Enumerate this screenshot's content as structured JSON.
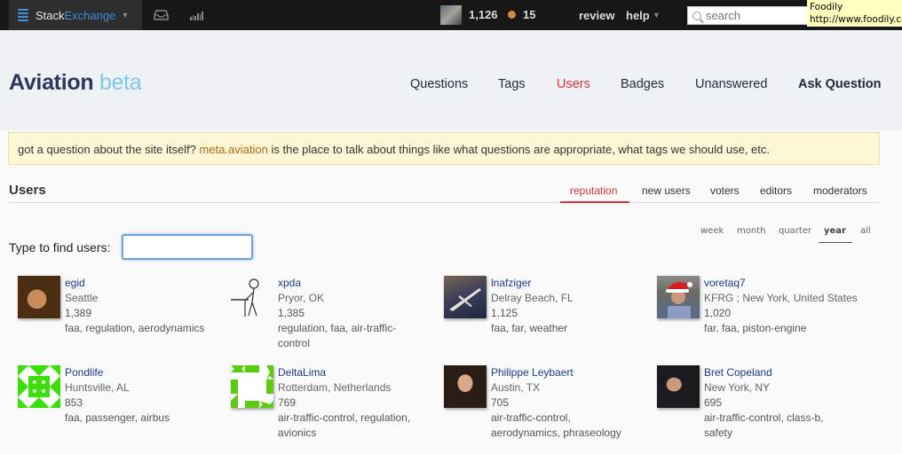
{
  "topbar": {
    "brand_left": "Stack",
    "brand_right": "Exchange",
    "reputation": "1,126",
    "bronze_badges": "15",
    "review_label": "review",
    "help_label": "help",
    "search_placeholder": "search",
    "icons": {
      "logo": "stackexchange-logo-icon",
      "caret": "caret-down-icon",
      "inbox": "inbox-icon",
      "achievements": "achievements-icon",
      "search": "search-icon"
    }
  },
  "tooltip": {
    "title": "Foodily",
    "url": "http://www.foodily.com"
  },
  "header": {
    "site_name": "Aviation",
    "site_suffix": "beta",
    "nav": [
      {
        "label": "Questions"
      },
      {
        "label": "Tags"
      },
      {
        "label": "Users",
        "active": true
      },
      {
        "label": "Badges"
      },
      {
        "label": "Unanswered"
      },
      {
        "label": "Ask Question"
      }
    ]
  },
  "notice": {
    "before": "got a question about the site itself? ",
    "link": "meta.aviation",
    "after": " is the place to talk about things like what questions are appropriate, what tags we should use, etc."
  },
  "users": {
    "title": "Users",
    "tabs": [
      {
        "label": "reputation",
        "active": true
      },
      {
        "label": "new users"
      },
      {
        "label": "voters"
      },
      {
        "label": "editors"
      },
      {
        "label": "moderators"
      }
    ],
    "periods": [
      {
        "label": "week"
      },
      {
        "label": "month"
      },
      {
        "label": "quarter"
      },
      {
        "label": "year",
        "active": true
      },
      {
        "label": "all"
      }
    ],
    "find_label": "Type to find users:",
    "find_value": "",
    "list": [
      {
        "name": "egid",
        "location": "Seattle",
        "reputation": "1,389",
        "tags": "faa, regulation, aerodynamics"
      },
      {
        "name": "xpda",
        "location": "Pryor, OK",
        "reputation": "1,385",
        "tags": "regulation, faa, air-traffic-control"
      },
      {
        "name": "lnafziger",
        "location": "Delray Beach, FL",
        "reputation": "1,125",
        "tags": "faa, far, weather"
      },
      {
        "name": "voretaq7",
        "location": "KFRG ; New York, United States",
        "reputation": "1,020",
        "tags": "far, faa, piston-engine"
      },
      {
        "name": "Pondlife",
        "location": "Huntsville, AL",
        "reputation": "853",
        "tags": "faa, passenger, airbus"
      },
      {
        "name": "DeltaLima",
        "location": "Rotterdam, Netherlands",
        "reputation": "769",
        "tags": "air-traffic-control, regulation, avionics"
      },
      {
        "name": "Philippe Leybaert",
        "location": "Austin, TX",
        "reputation": "705",
        "tags": "air-traffic-control, aerodynamics, phraseology"
      },
      {
        "name": "Bret Copeland",
        "location": "New York, NY",
        "reputation": "695",
        "tags": "air-traffic-control, class-b, safety"
      }
    ]
  },
  "colors": {
    "topbar_bg": "#171717",
    "brand_blue": "#3c8de0",
    "active_red": "#e0303a",
    "title_navy": "#2b3a5c",
    "beta_blue": "#7ec8ee",
    "notice_bg": "#fdf7d6",
    "meta_link": "#b0671a",
    "username": "#1c3a8c",
    "identicon_green": "#3be00a"
  }
}
